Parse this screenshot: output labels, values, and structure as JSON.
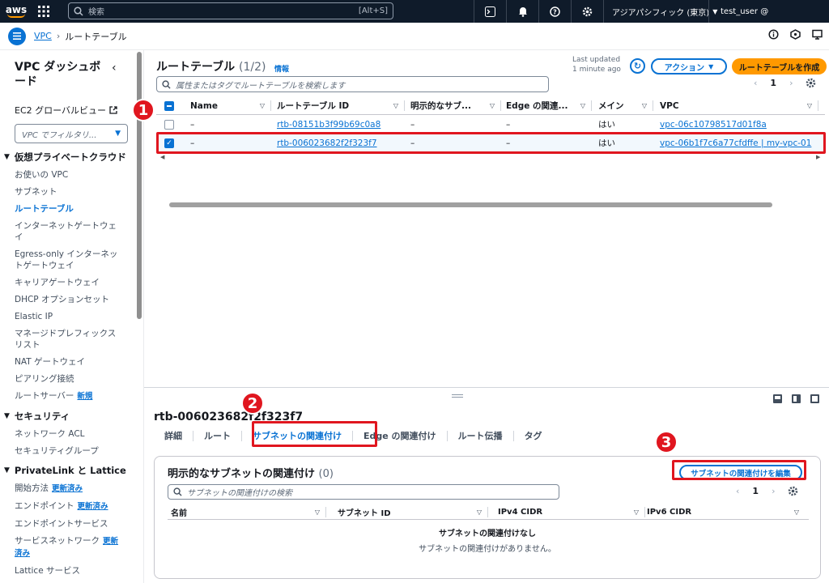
{
  "topbar": {
    "logo": "aws",
    "search_placeholder": "検索",
    "search_shortcut": "[Alt+S]",
    "icons": [
      "cloudshell-icon",
      "bell-icon",
      "help-icon",
      "settings-icon"
    ],
    "region": "アジアパシフィック (東京)",
    "user": "test_user @"
  },
  "breadcrumb": {
    "root": "VPC",
    "current": "ルートテーブル"
  },
  "sidebar": {
    "title": "VPC ダッシュボード",
    "ec2_link": "EC2 グローバルビュー",
    "filter_placeholder": "VPC でフィルタリ...",
    "sections": [
      {
        "title": "仮想プライベートクラウド",
        "items": [
          {
            "label": "お使いの VPC"
          },
          {
            "label": "サブネット"
          },
          {
            "label": "ルートテーブル",
            "active": true
          },
          {
            "label": "インターネットゲートウェイ"
          },
          {
            "label": "Egress-only インターネットゲートウェイ"
          },
          {
            "label": "キャリアゲートウェイ"
          },
          {
            "label": "DHCP オプションセット"
          },
          {
            "label": "Elastic IP"
          },
          {
            "label": "マネージドプレフィックスリスト"
          },
          {
            "label": "NAT ゲートウェイ"
          },
          {
            "label": "ピアリング接続"
          },
          {
            "label": "ルートサーバー",
            "badge": "新規"
          }
        ]
      },
      {
        "title": "セキュリティ",
        "items": [
          {
            "label": "ネットワーク ACL"
          },
          {
            "label": "セキュリティグループ"
          }
        ]
      },
      {
        "title": "PrivateLink と Lattice",
        "items": [
          {
            "label": "開始方法",
            "badge": "更新済み"
          },
          {
            "label": "エンドポイント",
            "badge": "更新済み"
          },
          {
            "label": "エンドポイントサービス"
          },
          {
            "label": "サービスネットワーク",
            "badge": "更新済み"
          },
          {
            "label": "Lattice サービス"
          }
        ]
      }
    ]
  },
  "main": {
    "title": "ルートテーブル",
    "count": "(1/2)",
    "info": "情報",
    "last_updated_1": "Last updated",
    "last_updated_2": "1 minute ago",
    "actions": "アクション",
    "create": "ルートテーブルを作成",
    "search_placeholder": "属性またはタグでルートテーブルを検索します",
    "page": "1",
    "columns": [
      "Name",
      "ルートテーブル ID",
      "明示的なサブ...",
      "Edge の関連...",
      "メイン",
      "VPC"
    ],
    "rows": [
      {
        "name": "–",
        "id": "rtb-08151b3f99b69c0a8",
        "explicit": "–",
        "edge": "–",
        "main": "はい",
        "vpc": "vpc-06c10798517d01f8a",
        "selected": false
      },
      {
        "name": "–",
        "id": "rtb-006023682f2f323f7",
        "explicit": "–",
        "edge": "–",
        "main": "はい",
        "vpc": "vpc-06b1f7c6a77cfdffe | my-vpc-01",
        "selected": true
      }
    ]
  },
  "detail": {
    "title": "rtb-006023682f2f323f7",
    "tabs": [
      "詳細",
      "ルート",
      "サブネットの関連付け",
      "Edge の関連付け",
      "ルート伝播",
      "タグ"
    ],
    "active_tab": 2,
    "box_title": "明示的なサブネットの関連付け",
    "box_count": "(0)",
    "edit_button": "サブネットの関連付けを編集",
    "search_placeholder": "サブネットの関連付けの検索",
    "page": "1",
    "columns": [
      "名前",
      "サブネット ID",
      "IPv4 CIDR",
      "IPv6 CIDR"
    ],
    "empty_title": "サブネットの関連付けなし",
    "empty_text": "サブネットの関連付けがありません。"
  },
  "annotations": [
    "1",
    "2",
    "3"
  ],
  "colors": {
    "accent": "#0972d3",
    "primary": "#ff9900",
    "highlight": "#e0161f",
    "topbar": "#0f1b2a"
  }
}
